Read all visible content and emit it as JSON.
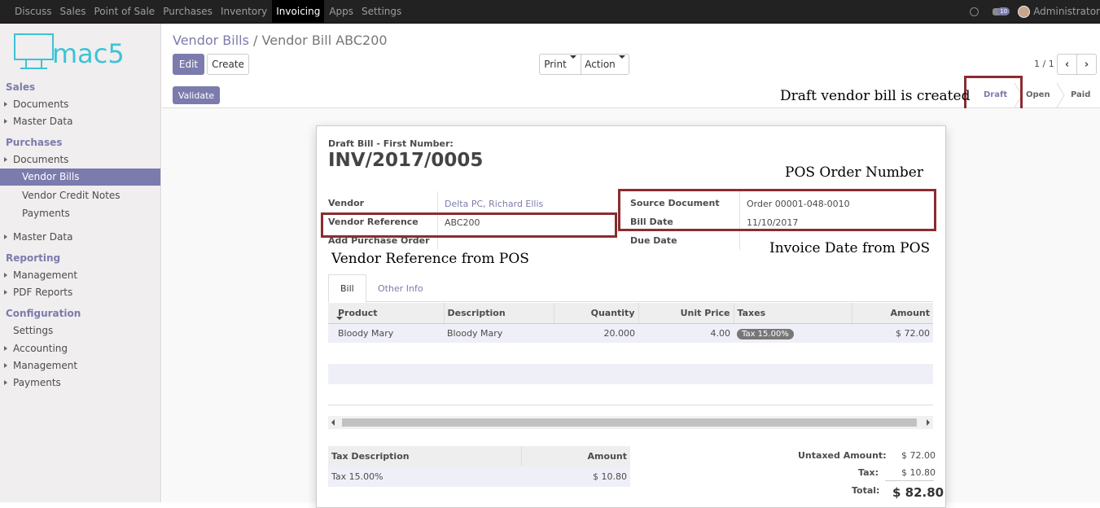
{
  "topbar": {
    "menu": [
      "Discuss",
      "Sales",
      "Point of Sale",
      "Purchases",
      "Inventory",
      "Invoicing",
      "Apps",
      "Settings"
    ],
    "active_menu": "Invoicing",
    "chat_badge": "10",
    "user": "Administrator"
  },
  "sidebar": {
    "logo_text": "mac5",
    "sales_title": "Sales",
    "sales_items": [
      "Documents",
      "Master Data"
    ],
    "purchases_title": "Purchases",
    "purchases_documents": "Documents",
    "purchases_sub": [
      "Vendor Bills",
      "Vendor Credit Notes",
      "Payments"
    ],
    "purchases_master": "Master Data",
    "reporting_title": "Reporting",
    "reporting_items": [
      "Management",
      "PDF Reports"
    ],
    "configuration_title": "Configuration",
    "configuration_items": [
      "Settings",
      "Accounting",
      "Management",
      "Payments"
    ]
  },
  "control_panel": {
    "breadcrumb_parent": "Vendor Bills",
    "breadcrumb_sep": "/",
    "breadcrumb_current": "Vendor Bill ABC200",
    "edit": "Edit",
    "create": "Create",
    "print": "Print",
    "action": "Action",
    "pager": "1 / 1"
  },
  "statusbar": {
    "validate": "Validate",
    "stages": [
      "Draft",
      "Open",
      "Paid"
    ],
    "active_stage": "Draft"
  },
  "form": {
    "draft_label": "Draft Bill - First Number:",
    "number": "INV/2017/0005",
    "vendor_label": "Vendor",
    "vendor_value": "Delta PC, Richard Ellis",
    "vendor_ref_label": "Vendor Reference",
    "vendor_ref_value": "ABC200",
    "add_po_label": "Add Purchase Order",
    "source_doc_label": "Source Document",
    "source_doc_value": "Order 00001-048-0010",
    "bill_date_label": "Bill Date",
    "bill_date_value": "11/10/2017",
    "due_date_label": "Due Date",
    "tabs": [
      "Bill",
      "Other Info"
    ]
  },
  "lines": {
    "headers": [
      "Product",
      "Description",
      "Quantity",
      "Unit Price",
      "Taxes",
      "Amount"
    ],
    "rows": [
      {
        "product": "Bloody Mary",
        "description": "Bloody Mary",
        "quantity": "20.000",
        "unit_price": "4.00",
        "taxes": "Tax 15.00%",
        "amount": "$ 72.00"
      }
    ]
  },
  "tax_table": {
    "headers": [
      "Tax Description",
      "Amount"
    ],
    "rows": [
      {
        "description": "Tax 15.00%",
        "amount": "$ 10.80"
      }
    ]
  },
  "totals": {
    "untaxed_label": "Untaxed Amount:",
    "untaxed_value": "$ 72.00",
    "tax_label": "Tax:",
    "tax_value": "$ 10.80",
    "total_label": "Total:",
    "total_value": "$ 82.80"
  },
  "annotations": {
    "draft": "Draft vendor bill is created",
    "pos_order": "POS Order Number",
    "invoice_date": "Invoice Date from POS",
    "vendor_ref": "Vendor Reference from POS"
  },
  "colors": {
    "accent": "#7c7bad",
    "annotation_box": "#8b2c30",
    "topbar": "#222222"
  }
}
